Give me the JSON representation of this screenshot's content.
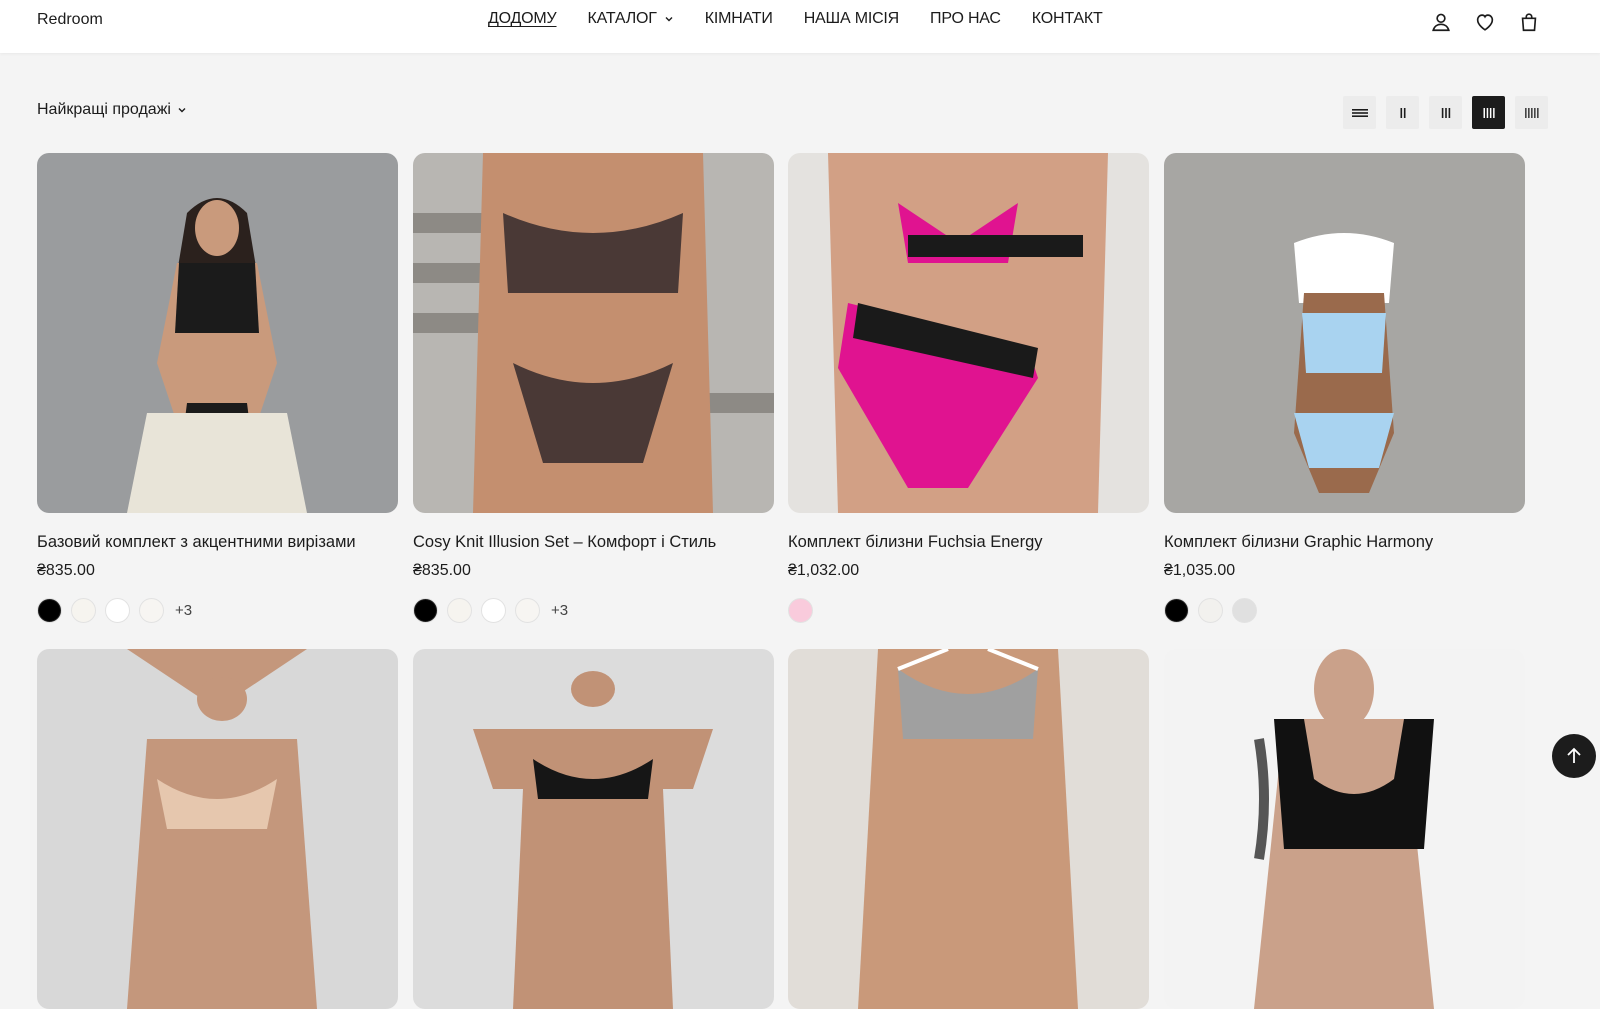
{
  "header": {
    "logo": "Redroom",
    "nav": [
      {
        "label": "ДОДОМУ",
        "active": true,
        "dropdown": false
      },
      {
        "label": "КАТАЛОГ",
        "active": false,
        "dropdown": true
      },
      {
        "label": "КІМНАТИ",
        "active": false,
        "dropdown": false
      },
      {
        "label": "НАША МІСІЯ",
        "active": false,
        "dropdown": false
      },
      {
        "label": "ПРО НАС",
        "active": false,
        "dropdown": false
      },
      {
        "label": "КОНТАКТ",
        "active": false,
        "dropdown": false
      }
    ],
    "icons": [
      "account-icon",
      "wishlist-heart-icon",
      "cart-bag-icon"
    ]
  },
  "toolbar": {
    "sort_label": "Найкращі продажі",
    "grid_options": [
      {
        "name": "list-view",
        "active": false
      },
      {
        "name": "grid-2",
        "active": false
      },
      {
        "name": "grid-3",
        "active": false
      },
      {
        "name": "grid-4",
        "active": true
      },
      {
        "name": "grid-5",
        "active": false
      }
    ]
  },
  "products": [
    {
      "title": "Базовий комплект з акцентними вирізами",
      "price": "₴835.00",
      "swatches": [
        "#000000",
        "#f6f4ef",
        "#ffffff",
        "#f7f5f2"
      ],
      "selected_swatch": 0,
      "more": "+3",
      "image": {
        "bg": "#9a9c9e",
        "skin": "#c99a7c",
        "garment": "#1b1b1b",
        "accent": "#e8e4d8"
      }
    },
    {
      "title": "Cosy Knit Illusion Set – Комфорт і Стиль",
      "price": "₴835.00",
      "swatches": [
        "#000000",
        "#f6f4ef",
        "#ffffff",
        "#f7f5f2"
      ],
      "selected_swatch": 0,
      "more": "+3",
      "image": {
        "bg": "#b8b6b2",
        "skin": "#c48f6f",
        "garment": "#4a3936",
        "accent": "#8d8a85"
      }
    },
    {
      "title": "Комплект білизни Fuchsia Energy",
      "price": "₴1,032.00",
      "swatches": [
        "#f9cbdc"
      ],
      "selected_swatch": -1,
      "more": "",
      "image": {
        "bg": "#e4e2df",
        "skin": "#d2a085",
        "garment": "#e01390",
        "accent": "#1a1a1a"
      }
    },
    {
      "title": "Комплект білизни Graphic Harmony",
      "price": "₴1,035.00",
      "swatches": [
        "#000000",
        "#f2f1ee",
        "#e0e0e0"
      ],
      "selected_swatch": 0,
      "more": "",
      "image": {
        "bg": "#a7a6a3",
        "skin": "#9a6a4c",
        "garment": "#a9d3f0",
        "accent": "#ffffff"
      }
    },
    {
      "title": "",
      "price": "",
      "swatches": [],
      "more": "",
      "image": {
        "bg": "#d8d8d8",
        "skin": "#c4977c",
        "garment": "#e6c7ae",
        "accent": "#ffffff"
      }
    },
    {
      "title": "",
      "price": "",
      "swatches": [],
      "more": "",
      "image": {
        "bg": "#dcdcdc",
        "skin": "#c19276",
        "garment": "#161616",
        "accent": "#ffffff"
      }
    },
    {
      "title": "",
      "price": "",
      "swatches": [],
      "more": "",
      "image": {
        "bg": "#e1ddd8",
        "skin": "#c9997a",
        "garment": "#a0a0a0",
        "accent": "#ffffff"
      }
    },
    {
      "title": "",
      "price": "",
      "swatches": [],
      "more": "",
      "image": {
        "bg": "#f3f3f3",
        "skin": "#caa18a",
        "garment": "#111111",
        "accent": "#555555"
      }
    }
  ],
  "scroll_top": {
    "icon": "arrow-up-icon"
  }
}
